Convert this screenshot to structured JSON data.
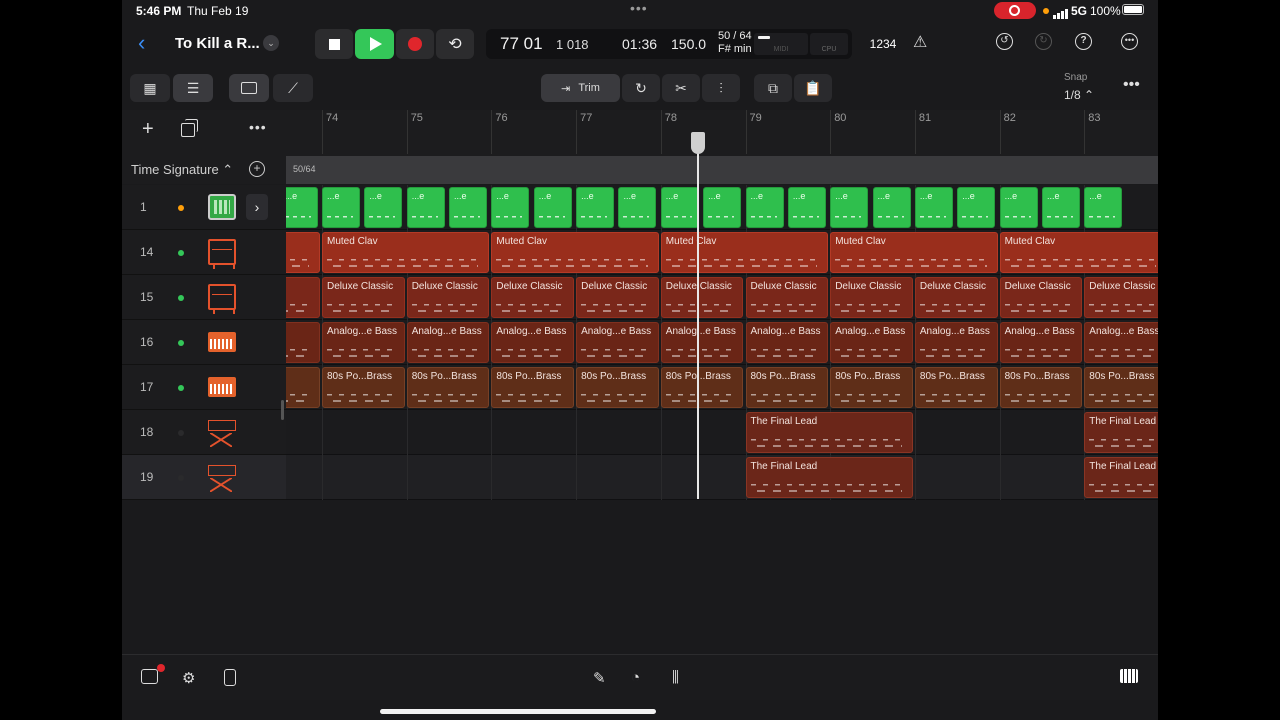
{
  "status": {
    "time": "5:46 PM",
    "date": "Thu Feb 19",
    "network": "5G",
    "battery": "100%"
  },
  "header": {
    "title": "To Kill a R...",
    "chevron": "⌄"
  },
  "transport": {
    "position_bars": "77 01",
    "position_ticks": "1 018",
    "clock": "01:36",
    "tempo": "150.0",
    "time_signature": "50 / 64",
    "key": "F# min",
    "midi_label": "MIDI",
    "cpu_label": "CPU",
    "count_in": "1234"
  },
  "toolbar": {
    "trim_label": "Trim",
    "snap_label": "Snap",
    "snap_value": "1/8 ⌃"
  },
  "track_header": {
    "time_signature_label": "Time Signature ⌃"
  },
  "time_signature_marker": "50/64",
  "ruler": {
    "bars": [
      "74",
      "75",
      "76",
      "77",
      "78",
      "79",
      "80",
      "81",
      "82",
      "83"
    ]
  },
  "tracks": [
    {
      "number": "1",
      "dot_color": "#ff9f0a",
      "instrument": "drum-machine-icon"
    },
    {
      "number": "14",
      "dot_color": "#34c759",
      "instrument": "electric-piano-icon"
    },
    {
      "number": "15",
      "dot_color": "#34c759",
      "instrument": "electric-piano-icon"
    },
    {
      "number": "16",
      "dot_color": "#34c759",
      "instrument": "synth-keyboard-icon"
    },
    {
      "number": "17",
      "dot_color": "#34c759",
      "instrument": "synth-keyboard-icon"
    },
    {
      "number": "18",
      "dot_color": "#2a2a2c",
      "instrument": "keyboard-stand-icon"
    },
    {
      "number": "19",
      "dot_color": "#2a2a2c",
      "instrument": "keyboard-stand-icon"
    }
  ],
  "regions": {
    "drum": "...e",
    "muted": [
      "lav",
      "Muted Clav",
      "Muted Clav",
      "Muted Clav",
      "Muted Clav",
      "Muted Clav"
    ],
    "deluxe": [
      "lassic",
      "Deluxe Classic",
      "Deluxe Classic",
      "Deluxe Classic",
      "Deluxe Classic",
      "Deluxe Classic",
      "Deluxe Classic",
      "Deluxe Classic",
      "Deluxe Classic",
      "Deluxe Classic",
      "Deluxe Classic"
    ],
    "analog": [
      "e Bass",
      "Analog...e Bass",
      "Analog...e Bass",
      "Analog...e Bass",
      "Analog...e Bass",
      "Analog...e Bass",
      "Analog...e Bass",
      "Analog...e Bass",
      "Analog...e Bass",
      "Analog...e Bass",
      "Analog...e Bass"
    ],
    "brass": [
      "Brass",
      "80s Po...Brass",
      "80s Po...Brass",
      "80s Po...Brass",
      "80s Po...Brass",
      "80s Po...Brass",
      "80s Po...Brass",
      "80s Po...Brass",
      "80s Po...Brass",
      "80s Po...Brass",
      "80s Po...Brass"
    ],
    "lead": [
      "The Final Lead",
      "The Final Lead",
      "The Final Lead",
      "The Final Lead"
    ]
  },
  "colors": {
    "accent": "#3a8ef6",
    "play": "#34c759",
    "record": "#e0262c",
    "drum_region": "#2fbf4d"
  }
}
